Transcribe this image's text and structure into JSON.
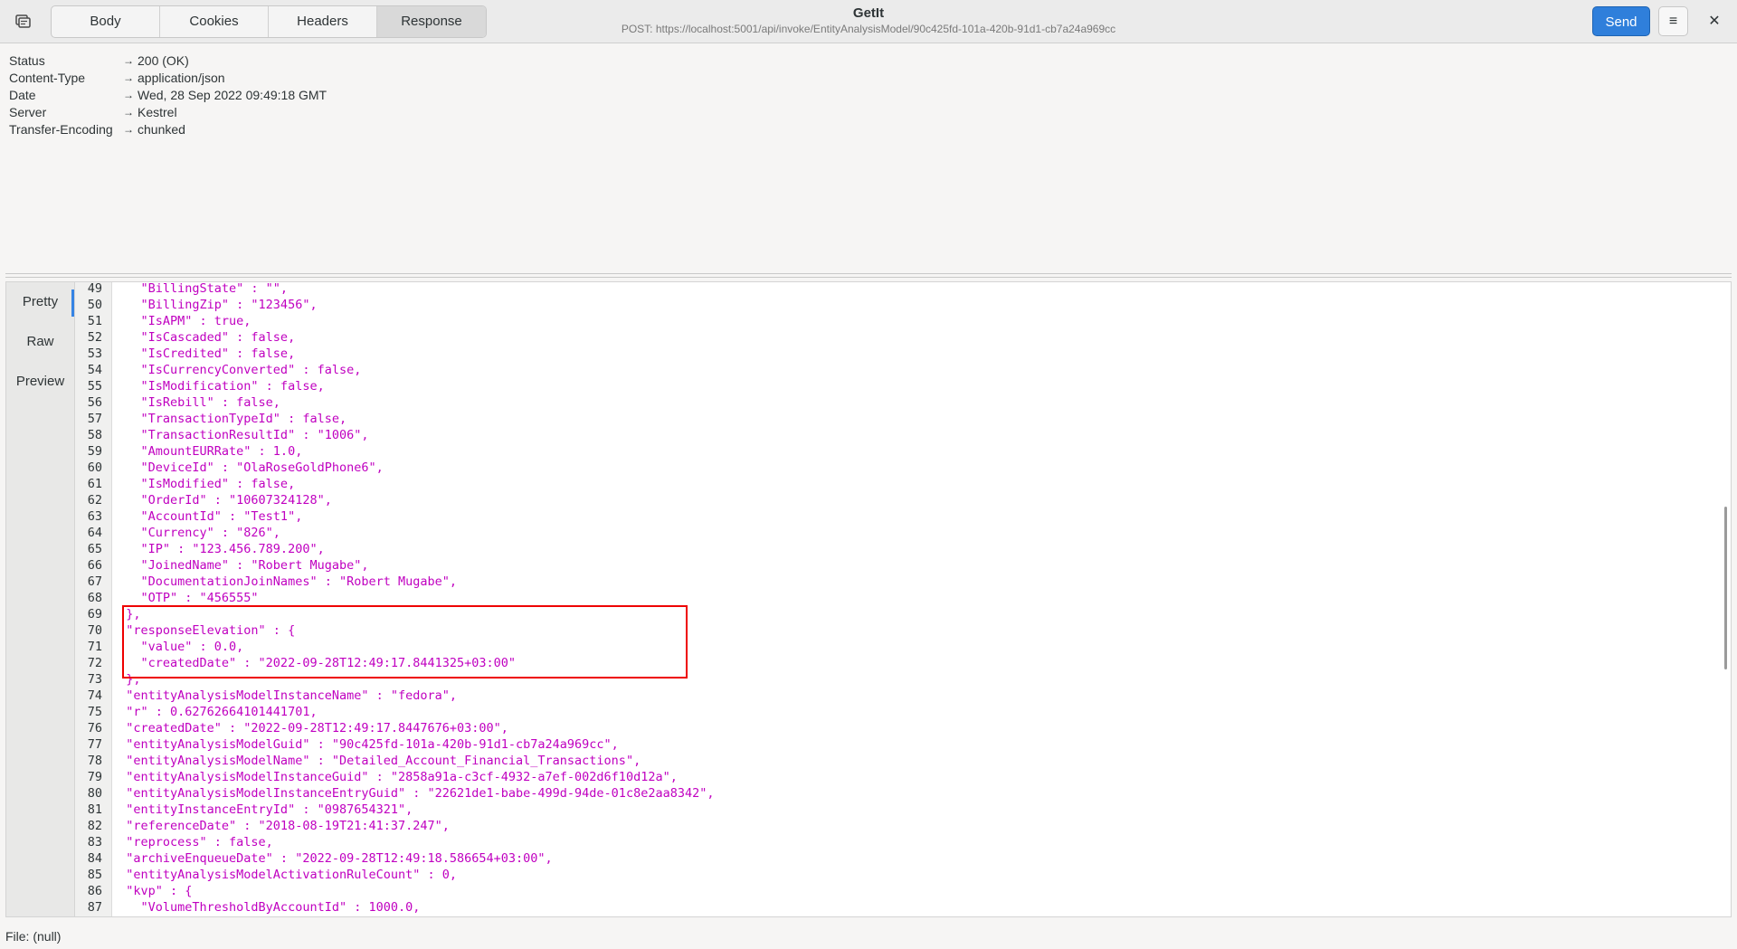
{
  "header": {
    "tabs": [
      {
        "label": "Body"
      },
      {
        "label": "Cookies"
      },
      {
        "label": "Headers"
      },
      {
        "label": "Response"
      }
    ],
    "title": "GetIt",
    "subtitle": "POST: https://localhost:5001/api/invoke/EntityAnalysisModel/90c425fd-101a-420b-91d1-cb7a24a969cc",
    "send_label": "Send",
    "menu_icon": "≡",
    "close_icon": "✕"
  },
  "response_headers": [
    {
      "key": "Status",
      "value": "200 (OK)"
    },
    {
      "key": "Content-Type",
      "value": "application/json"
    },
    {
      "key": "Date",
      "value": "Wed, 28 Sep 2022 09:49:18 GMT"
    },
    {
      "key": "Server",
      "value": "Kestrel"
    },
    {
      "key": "Transfer-Encoding",
      "value": "chunked"
    }
  ],
  "arrow": "→",
  "view_tabs": [
    {
      "label": "Pretty"
    },
    {
      "label": "Raw"
    },
    {
      "label": "Preview"
    }
  ],
  "code_lines": [
    {
      "n": "49",
      "t": "    \"BillingState\" : \"\","
    },
    {
      "n": "50",
      "t": "    \"BillingZip\" : \"123456\","
    },
    {
      "n": "51",
      "t": "    \"IsAPM\" : true,"
    },
    {
      "n": "52",
      "t": "    \"IsCascaded\" : false,"
    },
    {
      "n": "53",
      "t": "    \"IsCredited\" : false,"
    },
    {
      "n": "54",
      "t": "    \"IsCurrencyConverted\" : false,"
    },
    {
      "n": "55",
      "t": "    \"IsModification\" : false,"
    },
    {
      "n": "56",
      "t": "    \"IsRebill\" : false,"
    },
    {
      "n": "57",
      "t": "    \"TransactionTypeId\" : false,"
    },
    {
      "n": "58",
      "t": "    \"TransactionResultId\" : \"1006\","
    },
    {
      "n": "59",
      "t": "    \"AmountEURRate\" : 1.0,"
    },
    {
      "n": "60",
      "t": "    \"DeviceId\" : \"OlaRoseGoldPhone6\","
    },
    {
      "n": "61",
      "t": "    \"IsModified\" : false,"
    },
    {
      "n": "62",
      "t": "    \"OrderId\" : \"10607324128\","
    },
    {
      "n": "63",
      "t": "    \"AccountId\" : \"Test1\","
    },
    {
      "n": "64",
      "t": "    \"Currency\" : \"826\","
    },
    {
      "n": "65",
      "t": "    \"IP\" : \"123.456.789.200\","
    },
    {
      "n": "66",
      "t": "    \"JoinedName\" : \"Robert Mugabe\","
    },
    {
      "n": "67",
      "t": "    \"DocumentationJoinNames\" : \"Robert Mugabe\","
    },
    {
      "n": "68",
      "t": "    \"OTP\" : \"456555\""
    },
    {
      "n": "69",
      "t": "  },"
    },
    {
      "n": "70",
      "t": "  \"responseElevation\" : {"
    },
    {
      "n": "71",
      "t": "    \"value\" : 0.0,"
    },
    {
      "n": "72",
      "t": "    \"createdDate\" : \"2022-09-28T12:49:17.8441325+03:00\""
    },
    {
      "n": "73",
      "t": "  },"
    },
    {
      "n": "74",
      "t": "  \"entityAnalysisModelInstanceName\" : \"fedora\","
    },
    {
      "n": "75",
      "t": "  \"r\" : 0.62762664101441701,"
    },
    {
      "n": "76",
      "t": "  \"createdDate\" : \"2022-09-28T12:49:17.8447676+03:00\","
    },
    {
      "n": "77",
      "t": "  \"entityAnalysisModelGuid\" : \"90c425fd-101a-420b-91d1-cb7a24a969cc\","
    },
    {
      "n": "78",
      "t": "  \"entityAnalysisModelName\" : \"Detailed_Account_Financial_Transactions\","
    },
    {
      "n": "79",
      "t": "  \"entityAnalysisModelInstanceGuid\" : \"2858a91a-c3cf-4932-a7ef-002d6f10d12a\","
    },
    {
      "n": "80",
      "t": "  \"entityAnalysisModelInstanceEntryGuid\" : \"22621de1-babe-499d-94de-01c8e2aa8342\","
    },
    {
      "n": "81",
      "t": "  \"entityInstanceEntryId\" : \"0987654321\","
    },
    {
      "n": "82",
      "t": "  \"referenceDate\" : \"2018-08-19T21:41:37.247\","
    },
    {
      "n": "83",
      "t": "  \"reprocess\" : false,"
    },
    {
      "n": "84",
      "t": "  \"archiveEnqueueDate\" : \"2022-09-28T12:49:18.586654+03:00\","
    },
    {
      "n": "85",
      "t": "  \"entityAnalysisModelActivationRuleCount\" : 0,"
    },
    {
      "n": "86",
      "t": "  \"kvp\" : {"
    },
    {
      "n": "87",
      "t": "    \"VolumeThresholdByAccountId\" : 1000.0,"
    }
  ],
  "status": "File: (null)",
  "colors": {
    "accent": "#2f7fdb",
    "json_text": "#c000c0",
    "highlight": "#ee0000"
  }
}
